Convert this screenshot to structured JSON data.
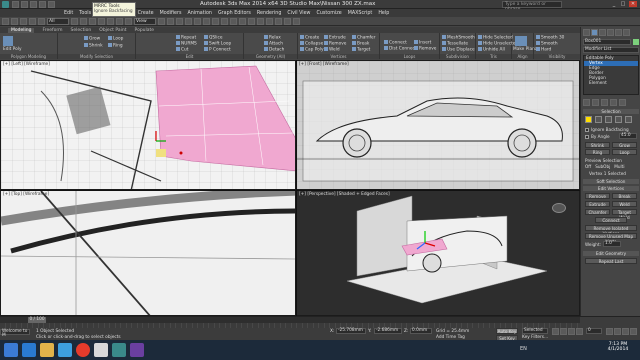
{
  "titlebar": {
    "title": "Autodesk 3ds Max  2014 x64     3D Studio Max\\Nissan 300 ZX.max",
    "search_placeholder": "Type a keyword or phrase",
    "min": "_",
    "max": "□",
    "close": "✕"
  },
  "menubar": {
    "items": [
      "Edit",
      "Tools",
      "Group",
      "Views",
      "Create",
      "Modifiers",
      "Animation",
      "Graph Editors",
      "Rendering",
      "Civil View",
      "Customize",
      "MAXScript",
      "Help"
    ]
  },
  "toolbar": {
    "selection_filter": "All",
    "view_dropdown": "View",
    "tooltip_title": "MRRC Tools",
    "tooltip_sub": "Ignore Backfacing"
  },
  "ribbon": {
    "tabs": [
      "Modeling",
      "Freeform",
      "Selection",
      "Object Paint",
      "Populate"
    ],
    "active_tab": "Modeling",
    "groups": {
      "polygon_modeling": {
        "label": "Polygon Modeling",
        "items": [
          "Edit Poly"
        ]
      },
      "modify_selection": {
        "label": "Modify Selection",
        "items": [
          "Grow",
          "Shrink",
          "Loop",
          "Ring"
        ]
      },
      "edit": {
        "label": "Edit",
        "items": [
          "Repeat",
          "QSlice",
          "Swift Loop",
          "NURMS",
          "Cut",
          "P Connect",
          "Constraints"
        ]
      },
      "geometry_all": {
        "label": "Geometry (All)",
        "items": [
          "Relax",
          "Create",
          "Attach",
          "Collapse",
          "Detach",
          "Cap Poly"
        ]
      },
      "vertices": {
        "label": "Vertices",
        "items": [
          "Extrude",
          "Remove",
          "Chamfer",
          "Break",
          "Weld",
          "Target"
        ]
      },
      "loops": {
        "label": "Loops",
        "items": [
          "Connect",
          "Insert",
          "Dist Connect",
          "Remove"
        ]
      },
      "subdivision": {
        "label": "Subdivision",
        "items": [
          "MeshSmooth",
          "Tessellate",
          "Use Displace"
        ]
      },
      "tris": {
        "label": "Tris",
        "items": [
          "Make Planar",
          "To View",
          "To Grid"
        ]
      },
      "align": {
        "label": "Align",
        "items": [
          "Hide Selected",
          "Hide Unselected",
          "Unhide All"
        ]
      },
      "visibility": {
        "label": "Visibility",
        "items": [
          "Smooth 30",
          "Smooth",
          "Hard"
        ]
      },
      "properties": {
        "label": "Properties",
        "items": [
          "Color",
          "Illum",
          "Alpha"
        ]
      }
    }
  },
  "viewports": {
    "top_left": {
      "label": "[+] [Left] [Wireframe]"
    },
    "top_right": {
      "label": "[+] [Front] [Wireframe]"
    },
    "bottom_left": {
      "label": "[+] [Top] [Wireframe]"
    },
    "bottom_right": {
      "label": "[+] [Perspective] [Shaded + Edged Faces]"
    }
  },
  "cmdpanel": {
    "object_name": "Box001",
    "modifier_list": "Modifier List",
    "stack": [
      "Editable Poly",
      "Vertex",
      "Edge",
      "Border",
      "Polygon",
      "Element"
    ],
    "stack_selected": "Vertex",
    "selection_rollout": "Selection",
    "ignore_backfacing": "Ignore Backfacing",
    "by_angle": "By Angle",
    "by_angle_val": "45.0",
    "shrink": "Shrink",
    "grow": "Grow",
    "ring": "Ring",
    "loop": "Loop",
    "preview_selection": "Preview Selection",
    "preview_opts": [
      "Off",
      "SubObj",
      "Multi"
    ],
    "selected_text": "Vertex 1 Selected",
    "soft_selection": "Soft Selection",
    "edit_vertices": "Edit Vertices",
    "remove": "Remove",
    "break": "Break",
    "extrude": "Extrude",
    "weld": "Weld",
    "chamfer": "Chamfer",
    "target_weld": "Target Weld",
    "connect": "Connect",
    "remove_isolated": "Remove Isolated Vertices",
    "remove_unused": "Remove Unused Map Verts",
    "weight_label": "Weight:",
    "weight_val": "1.0",
    "edit_geometry": "Edit Geometry",
    "repeat_last": "Repeat Last"
  },
  "statusbar": {
    "time": "0 / 100",
    "objects_selected": "1 Object Selected",
    "prompt": "Click or click-and-drag to select objects",
    "welcome": "Welcome to M",
    "x_label": "X:",
    "x_val": "-25.708mm",
    "y_label": "Y:",
    "y_val": "-2.686mm",
    "z_label": "Z:",
    "z_val": "0.0mm",
    "grid": "Grid = 25.4mm",
    "autokey": "Auto Key",
    "selected": "Selected",
    "setkey": "Set Key",
    "keyfilters": "Key Filters...",
    "add_time_tag": "Add Time Tag",
    "frame": "0"
  },
  "taskbar": {
    "clock_time": "7:13 PM",
    "clock_date": "4/1/2014",
    "lang": "EN"
  },
  "colors": {
    "selected_poly": "#f0a8d0",
    "accent": "#2d6db5",
    "ui_bg": "#454545"
  }
}
